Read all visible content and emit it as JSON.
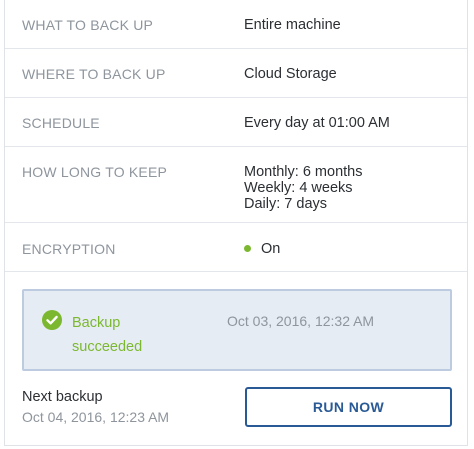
{
  "summary": {
    "rows": [
      {
        "label": "WHAT TO BACK UP",
        "value": [
          "Entire machine"
        ]
      },
      {
        "label": "WHERE TO BACK UP",
        "value": [
          "Cloud Storage"
        ]
      },
      {
        "label": "SCHEDULE",
        "value": [
          "Every day at 01:00 AM"
        ]
      },
      {
        "label": "HOW LONG TO KEEP",
        "value": [
          "Monthly: 6 months",
          "Weekly: 4 weeks",
          "Daily: 7 days"
        ]
      },
      {
        "label": "ENCRYPTION",
        "value": [
          "On"
        ]
      }
    ]
  },
  "status": {
    "line1": "Backup",
    "line2": "succeeded",
    "date": "Oct 03, 2016, 12:32 AM",
    "color": "#7cb82f",
    "icon": "check-circle-icon"
  },
  "next": {
    "label": "Next backup",
    "date": "Oct 04, 2016, 12:23 AM"
  },
  "actions": {
    "run_now_label": "RUN NOW",
    "accent": "#2a5a96"
  },
  "encryption_status_color": "#7cb82f"
}
